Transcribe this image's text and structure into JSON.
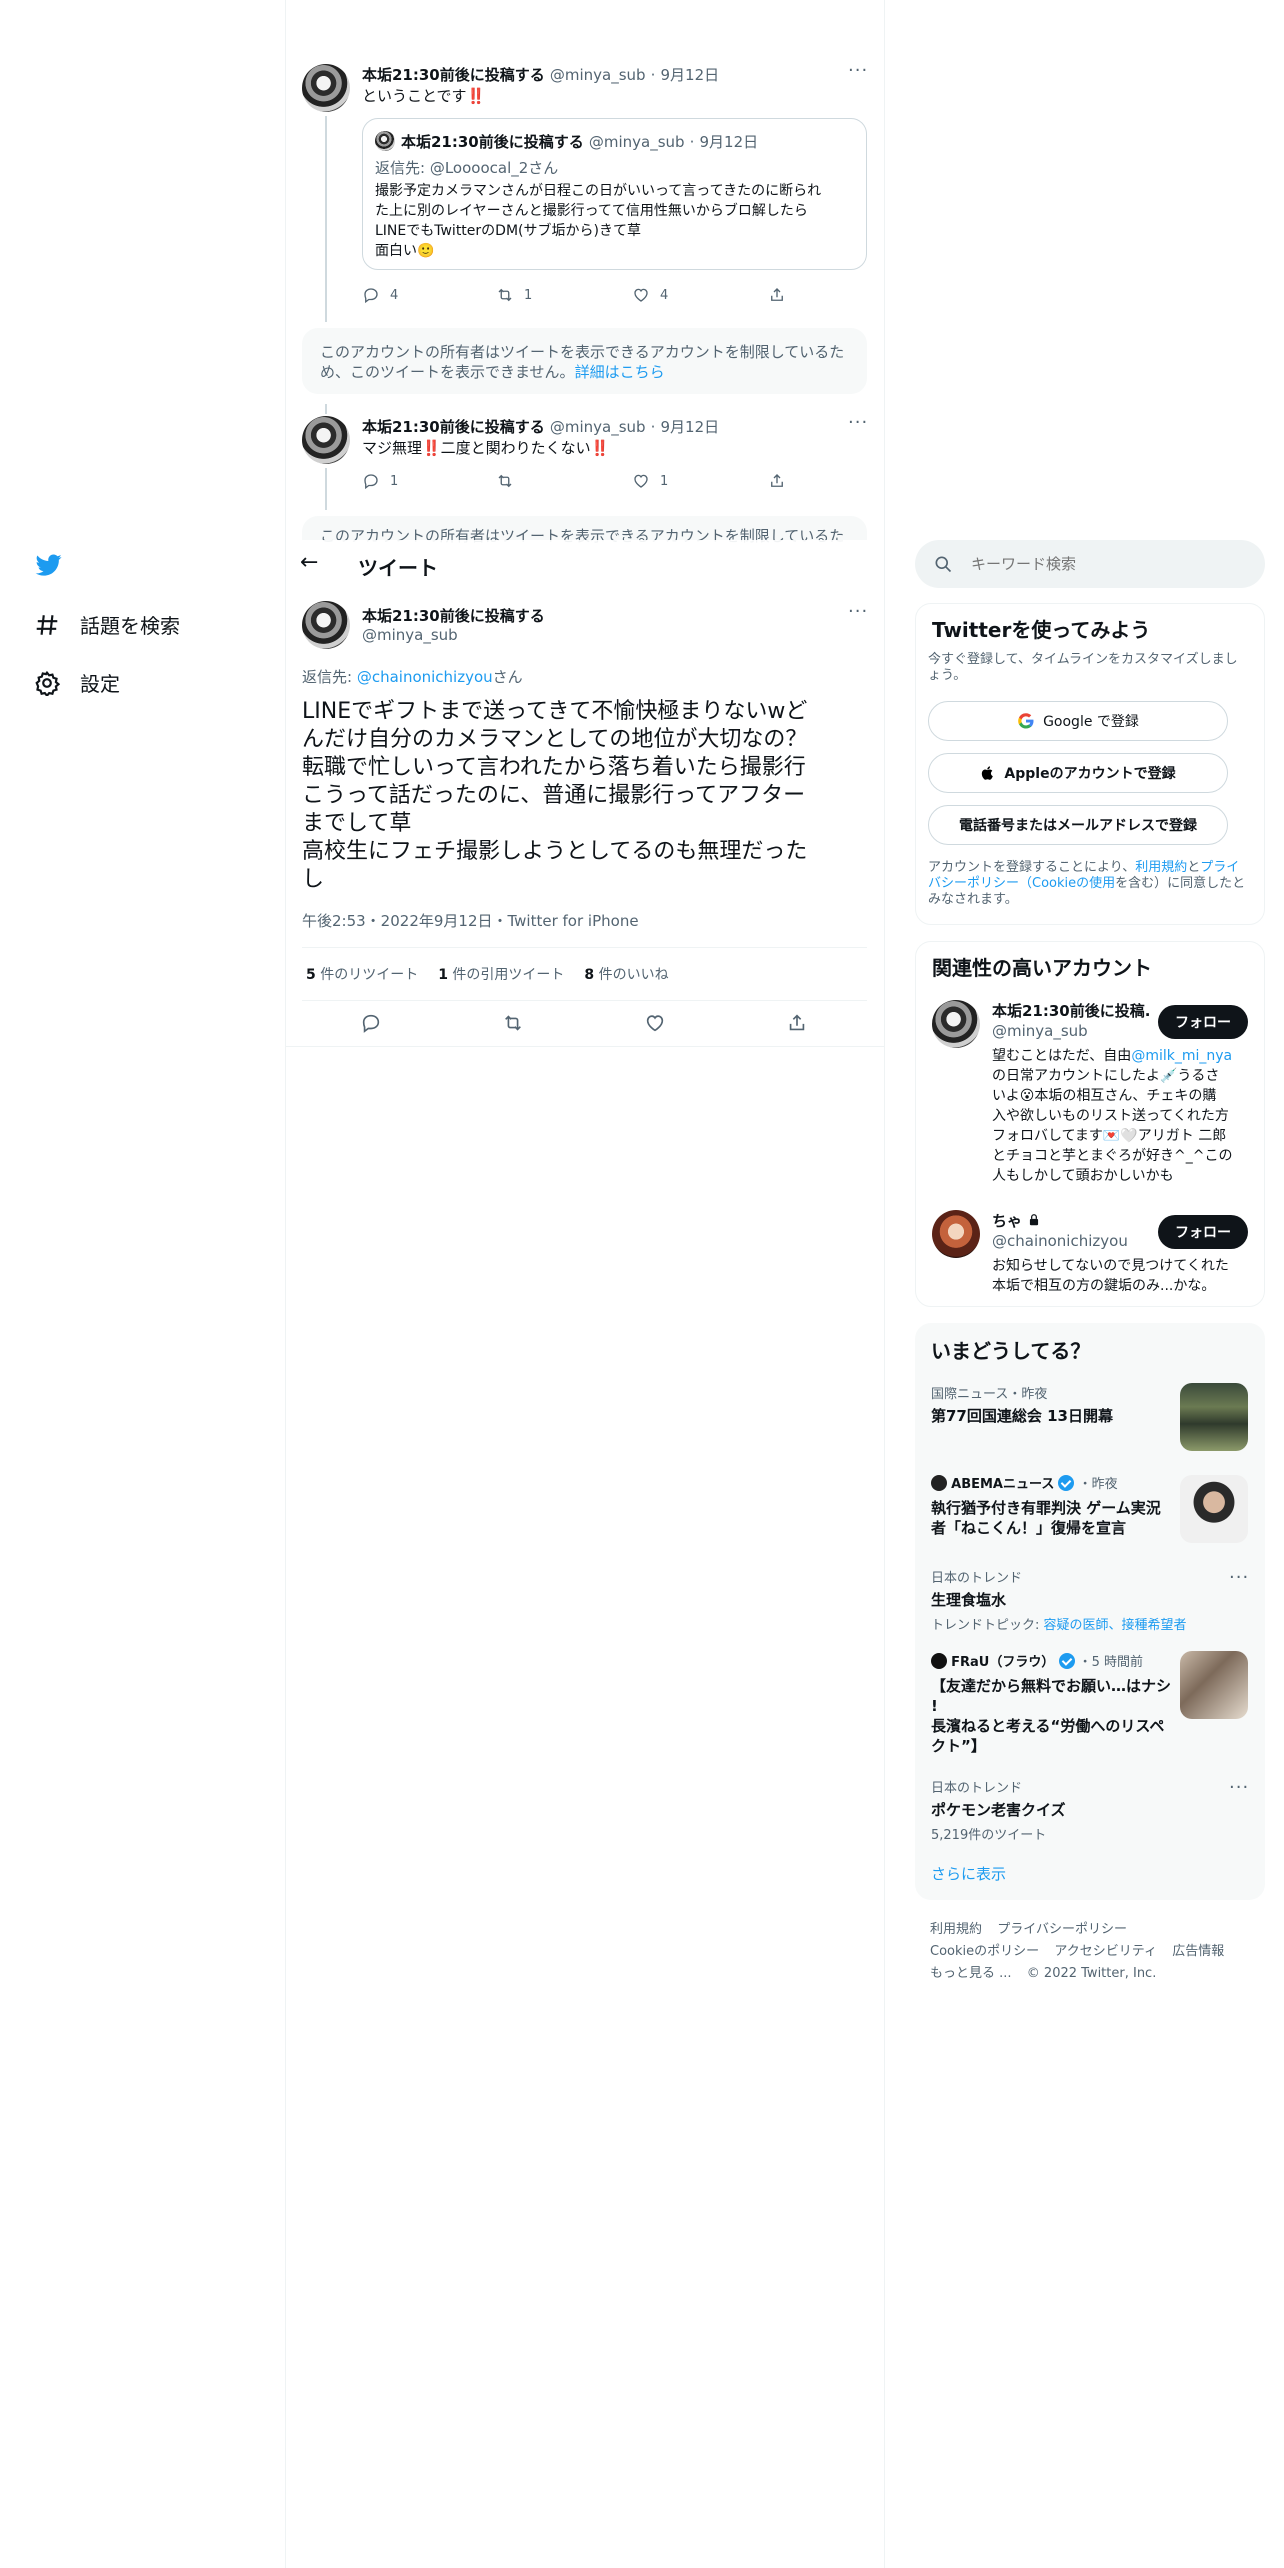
{
  "colors": {
    "accent": "#1d9bf0",
    "text": "#0f1419",
    "muted": "#536471",
    "like": "#f91880"
  },
  "nav": {
    "logo_icon": "twitter-bird-icon",
    "explore_label": "話題を検索",
    "settings_label": "設定"
  },
  "thread_top": {
    "tweet1": {
      "name": "本垢21:30前後に投稿する",
      "handle": "@minya_sub",
      "sep": "·",
      "date": "9月12日",
      "text": "ということです‼️",
      "quote": {
        "name": "本垢21:30前後に投稿する",
        "handle": "@minya_sub",
        "sep": "·",
        "date": "9月12日",
        "reply_prefix": "返信先: @Loooocal_2さん",
        "lines": [
          "撮影予定カメラマンさんが日程この日がいいって言ってきたのに断られ",
          "た上に別のレイヤーさんと撮影行ってて信用性無いからブロ解したら",
          "LINEでもTwitterのDM(サブ垢から)きて草",
          "面白い🙂"
        ]
      },
      "replies": "4",
      "retweets": "1",
      "likes": "4"
    },
    "notice1": "このアカウントの所有者はツイートを表示できるアカウントを制限しているた",
    "notice1_b": "め、このツイートを表示できません。",
    "notice_link": "詳細はこちら",
    "tweet2": {
      "name": "本垢21:30前後に投稿する",
      "handle": "@minya_sub",
      "sep": "·",
      "date": "9月12日",
      "text": "マジ無理‼️二度と関わりたくない‼️",
      "replies": "1",
      "likes": "1"
    },
    "notice2": "このアカウントの所有者はツイートを表示できるアカウントを制限しているた"
  },
  "header": {
    "back_label": "←",
    "title": "ツイート"
  },
  "main_tweet": {
    "name": "本垢21:30前後に投稿する",
    "handle": "@minya_sub",
    "reply_prefix": "返信先: ",
    "reply_to": "@chainonichizyou",
    "reply_suffix": "さん",
    "lines": [
      "LINEでギフトまで送ってきて不愉快極まりないwど",
      "んだけ自分のカメラマンとしての地位が大切なの？",
      "転職で忙しいって言われたから落ち着いたら撮影行",
      "こうって話だったのに、普通に撮影行ってアフター",
      "までして草",
      "高校生にフェチ撮影しようとしてるのも無理だった",
      "し"
    ],
    "timestamp": "午後2:53・2022年9月12日・Twitter for iPhone",
    "stats": {
      "retweets_count": "5",
      "retweets_label": "件のリツイート",
      "quotes_count": "1",
      "quotes_label": "件の引用ツイート",
      "likes_count": "8",
      "likes_label": "件のいいね"
    }
  },
  "search": {
    "placeholder": "キーワード検索"
  },
  "signup": {
    "title": "Twitterを使ってみよう",
    "subtitle_1": "今すぐ登録して、タイムラインをカスタマイズしまし",
    "subtitle_2": "ょう。",
    "google_label": "Google で登録",
    "apple_label": "Appleのアカウントで登録",
    "phone_label": "電話番号またはメールアドレスで登録",
    "terms_1": "アカウントを登録することにより、",
    "terms_link1": "利用規約",
    "terms_2": "と",
    "terms_link2": "プライ",
    "terms_link2b": "バシーポリシー（Cookieの使用",
    "terms_3": "を含む）に同意したと",
    "terms_4": "みなされます。"
  },
  "related": {
    "title": "関連性の高いアカウント",
    "follow_label": "フォロー",
    "accounts": [
      {
        "name": "本垢21:30前後に投稿...",
        "handle": "@minya_sub",
        "bio": [
          "望むことはただ、自由@milk_mi_nya",
          "の日常アカウントにしたよ💉うるさ",
          "いよ😮本垢の相互さん、チェキの購",
          "入や欲しいものリスト送ってくれた方",
          "フォロバしてます💌🤍アリガト 二郎",
          "とチョコと芋とまぐろが好き^_^この",
          "人もしかして頭おかしいかも"
        ]
      },
      {
        "name": "ちゃ",
        "handle": "@chainonichizyou",
        "bio": [
          "お知らせしてないので見つけてくれた",
          "本垢で相互の方の鍵垢のみ...かな。"
        ]
      }
    ]
  },
  "trends": {
    "title": "いまどうしてる？",
    "items": [
      {
        "category": "国際ニュース・昨夜",
        "title": "第77回国連総会 13日開幕"
      },
      {
        "source": "ABEMAニュース",
        "time": "・昨夜",
        "title_1": "執行猶予付き有罪判決 ゲーム実況",
        "title_2": "者「ねこくん！」復帰を宣言"
      },
      {
        "category": "日本のトレンド",
        "title": "生理食塩水",
        "topic_prefix": "トレンドトピック: ",
        "topic_links": "容疑の医師、接種希望者"
      },
      {
        "source": "FRaU（フラウ）",
        "time": "・5 時間前",
        "title_1": "【友達だから無料でお願い…はナシ",
        "title_2": "!",
        "title_3": "長濱ねると考える“労働へのリスペ",
        "title_4": "クト”】"
      },
      {
        "category": "日本のトレンド",
        "title": "ポケモン老害クイズ",
        "count": "5,219件のツイート"
      }
    ],
    "show_more": "さらに表示"
  },
  "footer": {
    "terms": "利用規約",
    "privacy": "プライバシーポリシー",
    "cookie": "Cookieのポリシー",
    "accessibility": "アクセシビリティ",
    "ads": "広告情報",
    "more": "もっと見る ...",
    "copyright": "© 2022 Twitter, Inc."
  }
}
